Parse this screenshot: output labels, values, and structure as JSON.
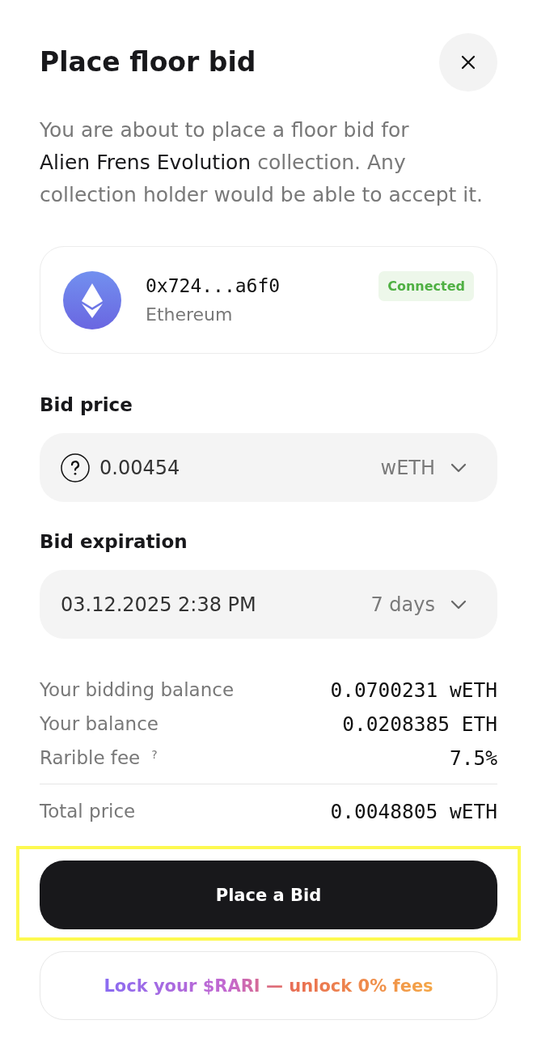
{
  "dialog": {
    "title": "Place floor bid",
    "description": "You are about to place a floor bid for **Alien Frens Evolution** collection. Any collection holder would be able to accept it."
  },
  "wallet": {
    "address": "0x724...a6f0",
    "network": "Ethereum",
    "status": "Connected",
    "connected": true
  },
  "fields": [
    {
      "kind": "amount",
      "label": "Bid price",
      "value": "0.00454",
      "option": "wETH"
    },
    {
      "kind": "date",
      "label": "Bid expiration",
      "value": "03.12.2025 2:38 PM",
      "option": "7 days"
    }
  ],
  "summary": [
    {
      "label": "Your bidding balance",
      "value": "0.0700231 wETH"
    },
    {
      "label": "Your balance",
      "value": "0.0208385 ETH"
    },
    {
      "label": "Rarible fee",
      "hint": "?",
      "value": "7.5%"
    }
  ],
  "total": {
    "label": "Total price",
    "value": "0.0048805 wETH"
  },
  "place_bid_button": {
    "label": "Place a Bid",
    "highlighted": true
  },
  "promo_button": {
    "label": "Lock your $RARI — unlock 0% fees"
  }
}
